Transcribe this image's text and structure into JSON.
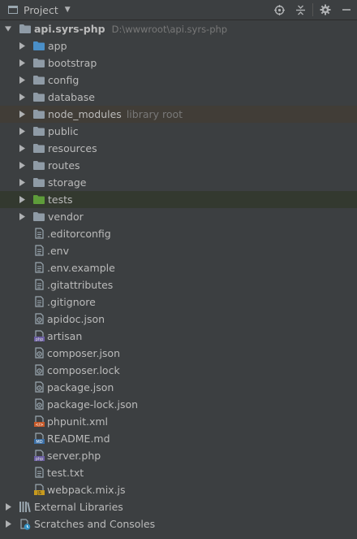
{
  "toolbar": {
    "title": "Project"
  },
  "root": {
    "name": "api.syrs-php",
    "path": "D:\\wwwroot\\api.syrs-php"
  },
  "folders": [
    {
      "label": "app",
      "color": "#4a8fc8",
      "hl": ""
    },
    {
      "label": "bootstrap",
      "color": "#8f9ba6",
      "hl": ""
    },
    {
      "label": "config",
      "color": "#8f9ba6",
      "hl": ""
    },
    {
      "label": "database",
      "color": "#8f9ba6",
      "hl": ""
    },
    {
      "label": "node_modules",
      "hint": "library root",
      "color": "#8f9ba6",
      "hl": "brown"
    },
    {
      "label": "public",
      "color": "#8f9ba6",
      "hl": ""
    },
    {
      "label": "resources",
      "color": "#8f9ba6",
      "hl": ""
    },
    {
      "label": "routes",
      "color": "#8f9ba6",
      "hl": ""
    },
    {
      "label": "storage",
      "color": "#8f9ba6",
      "hl": ""
    },
    {
      "label": "tests",
      "color": "#5e9c3a",
      "hl": "green"
    },
    {
      "label": "vendor",
      "color": "#8f9ba6",
      "hl": ""
    }
  ],
  "files": [
    {
      "label": ".editorconfig",
      "icon": "text-file-icon"
    },
    {
      "label": ".env",
      "icon": "text-file-icon"
    },
    {
      "label": ".env.example",
      "icon": "text-file-icon"
    },
    {
      "label": ".gitattributes",
      "icon": "text-file-icon"
    },
    {
      "label": ".gitignore",
      "icon": "text-file-icon"
    },
    {
      "label": "apidoc.json",
      "icon": "json-file-icon"
    },
    {
      "label": "artisan",
      "icon": "php-file-icon"
    },
    {
      "label": "composer.json",
      "icon": "json-file-icon"
    },
    {
      "label": "composer.lock",
      "icon": "json-file-icon"
    },
    {
      "label": "package.json",
      "icon": "json-file-icon"
    },
    {
      "label": "package-lock.json",
      "icon": "json-file-icon"
    },
    {
      "label": "phpunit.xml",
      "icon": "xml-file-icon"
    },
    {
      "label": "README.md",
      "icon": "markdown-file-icon"
    },
    {
      "label": "server.php",
      "icon": "php-file-icon"
    },
    {
      "label": "test.txt",
      "icon": "text-file-icon"
    },
    {
      "label": "webpack.mix.js",
      "icon": "js-file-icon"
    }
  ],
  "bottom": [
    {
      "label": "External Libraries",
      "icon": "library-icon"
    },
    {
      "label": "Scratches and Consoles",
      "icon": "scratches-icon"
    }
  ]
}
